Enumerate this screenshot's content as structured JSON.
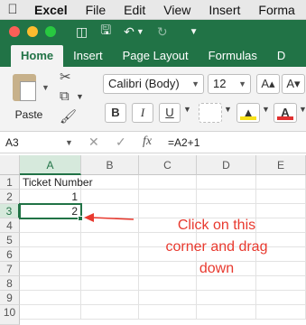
{
  "menubar": {
    "apple_icon": "apple-logo-icon",
    "items": [
      "Excel",
      "File",
      "Edit",
      "View",
      "Insert",
      "Forma"
    ]
  },
  "titlebar": {
    "icons": [
      "sidebar-icon",
      "save-icon",
      "undo-icon",
      "redo-icon",
      "customize-icon"
    ]
  },
  "ribbon_tabs": [
    "Home",
    "Insert",
    "Page Layout",
    "Formulas",
    "D"
  ],
  "ribbon": {
    "paste_label": "Paste",
    "font_name": "Calibri (Body)",
    "font_size": "12",
    "increase_font": "A▴",
    "decrease_font": "A▾",
    "bold": "B",
    "italic": "I",
    "underline": "U",
    "fill_color": "#f7e11a",
    "font_color": "#e03131"
  },
  "formula_bar": {
    "name_box": "A3",
    "fx": "fx",
    "formula": "=A2+1"
  },
  "grid": {
    "columns": [
      "A",
      "B",
      "C",
      "D",
      "E"
    ],
    "rows": [
      "1",
      "2",
      "3",
      "4",
      "5",
      "6",
      "7",
      "8",
      "9",
      "10"
    ],
    "cells": {
      "A1": "Ticket Number",
      "A2": "1",
      "A3": "2"
    },
    "selected_cell": "A3"
  },
  "annotation": {
    "line1": "Click on this",
    "line2": "corner and drag",
    "line3": "down",
    "color": "#e8392e"
  },
  "accent_color": "#217346"
}
